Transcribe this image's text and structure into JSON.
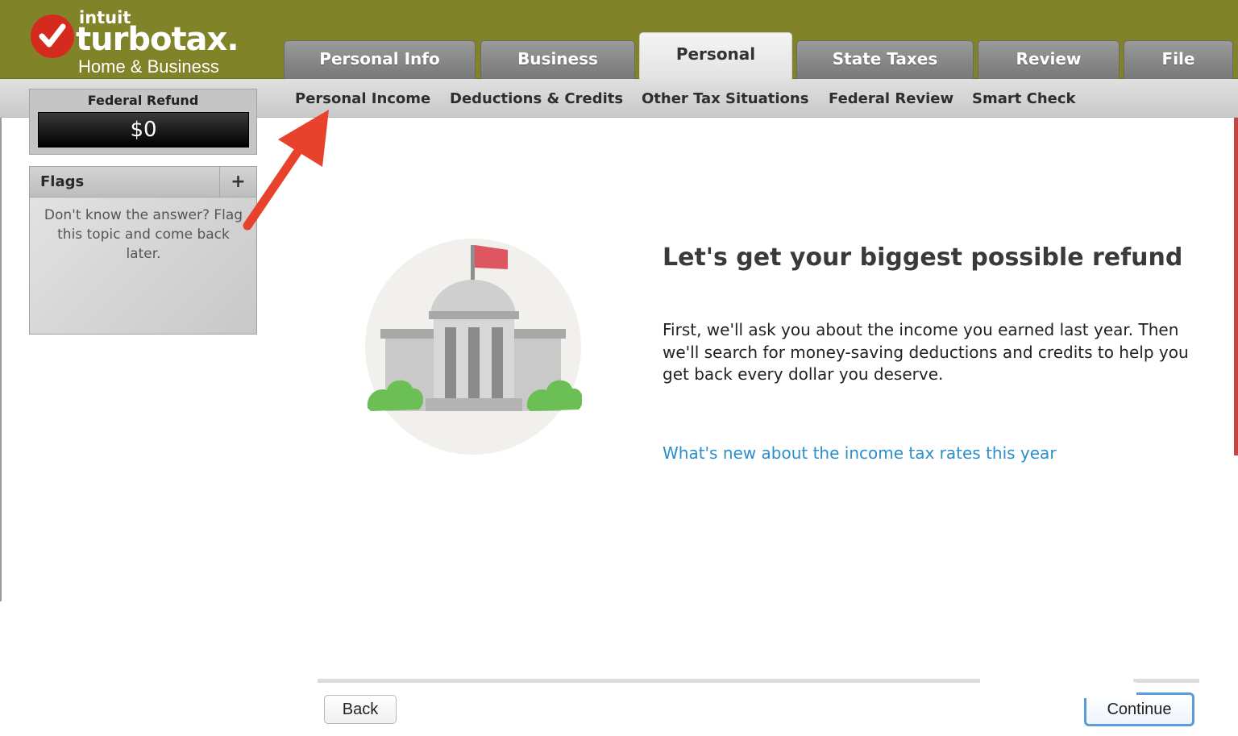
{
  "app": {
    "brand_small": "intuit",
    "brand_name": "turbotax.",
    "edition": "Home & Business",
    "colors": {
      "header_bg": "#818328",
      "logo_red": "#d52b1e",
      "link_blue": "#2b8ecd",
      "continue_border": "#5b9bd9",
      "arrow_red": "#e8412c",
      "flag_red": "#dd5660",
      "bush_green": "#6bbf55"
    }
  },
  "tabs": [
    {
      "label": "Personal Info",
      "active": false
    },
    {
      "label": "Business",
      "active": false
    },
    {
      "label": "Personal",
      "active": true
    },
    {
      "label": "State Taxes",
      "active": false
    },
    {
      "label": "Review",
      "active": false
    },
    {
      "label": "File",
      "active": false
    }
  ],
  "subnav": [
    {
      "label": "Personal Income"
    },
    {
      "label": "Deductions & Credits"
    },
    {
      "label": "Other Tax Situations"
    },
    {
      "label": "Federal Review"
    },
    {
      "label": "Smart Check"
    }
  ],
  "sidebar": {
    "refund_label": "Federal Refund",
    "refund_amount": "$0",
    "flags_title": "Flags",
    "flags_add": "+",
    "flags_help": "Don't know the answer? Flag this topic and come back later."
  },
  "main": {
    "heading": "Let's get your biggest possible refund",
    "body": "First, we'll ask you about the income you earned last year. Then we'll search for money-saving deductions and credits to help you get back every dollar you deserve.",
    "link": "What's new about the income tax rates this year",
    "illustration_icon": "capitol-building-icon"
  },
  "footer": {
    "back_label": "Back",
    "continue_label": "Continue"
  }
}
